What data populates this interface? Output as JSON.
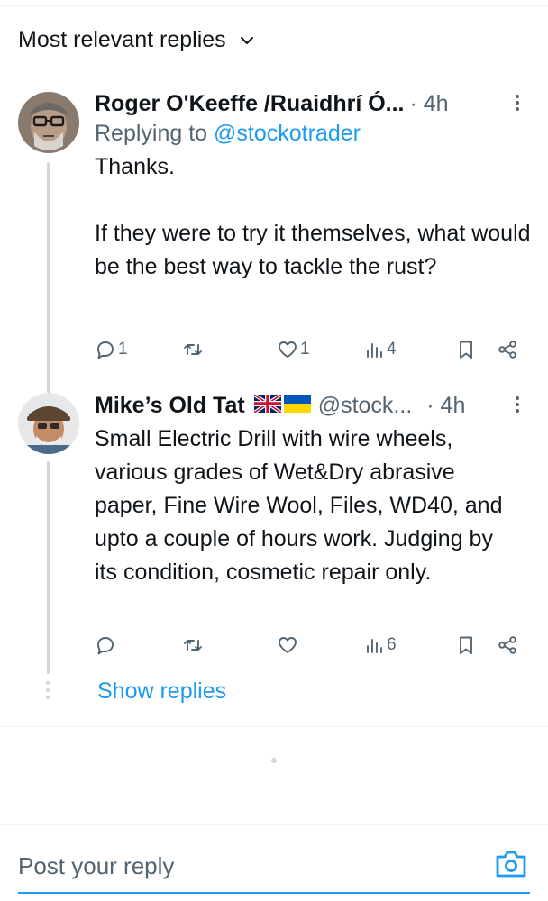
{
  "header": {
    "sort_label": "Most relevant replies"
  },
  "replies": [
    {
      "author": "Roger O'Keeffe /Ruaidhrí Ó...",
      "handle": "",
      "time": "· 4h",
      "replying_prefix": "Replying to ",
      "replying_to": "@stockotrader",
      "text": "Thanks.\n\nIf they were to try it themselves, what would be the best way to tackle the rust?",
      "stats": {
        "replies": "1",
        "reposts": "",
        "likes": "1",
        "views": "4"
      }
    },
    {
      "author": "Mike’s Old Tat",
      "flags": [
        "uk-flag-icon",
        "ukraine-flag-icon"
      ],
      "handle": "@stock...",
      "time": "· 4h",
      "text": "Small Electric Drill with wire wheels, various grades of Wet&Dry abrasive paper, Fine Wire Wool, Files, WD40, and upto a couple of hours work. Judging by its condition, cosmetic repair only.",
      "stats": {
        "replies": "",
        "reposts": "",
        "likes": "",
        "views": "6"
      }
    }
  ],
  "show_replies_label": "Show replies",
  "composer": {
    "placeholder": "Post your reply"
  },
  "colors": {
    "accent": "#1d9bf0",
    "secondary_text": "#536471",
    "primary_text": "#0f1419",
    "divider": "#eff3f4"
  },
  "icons": [
    "chevron-down-icon",
    "reply-icon",
    "repost-icon",
    "like-icon",
    "views-icon",
    "bookmark-icon",
    "share-icon",
    "more-icon",
    "camera-icon"
  ]
}
